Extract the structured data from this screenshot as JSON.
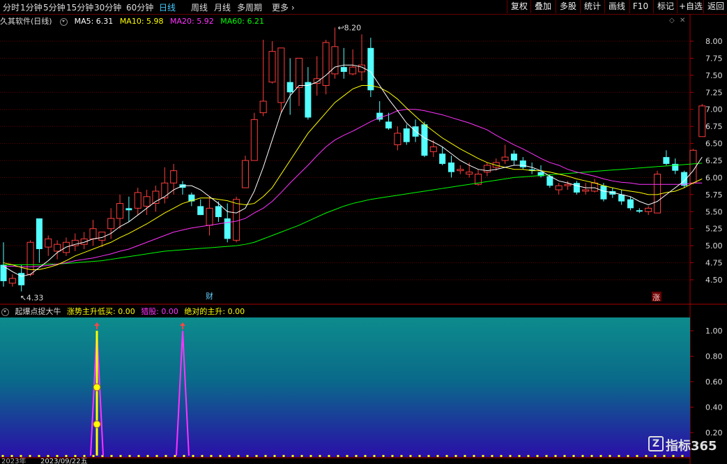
{
  "toolbar": {
    "timeframes": [
      {
        "label": "分时"
      },
      {
        "label": "1分钟"
      },
      {
        "label": "5分钟"
      },
      {
        "label": "15分钟"
      },
      {
        "label": "30分钟"
      },
      {
        "label": "60分钟"
      },
      {
        "label": "日线",
        "active": true
      },
      {
        "label": "周线"
      },
      {
        "label": "月线"
      },
      {
        "label": "多周期"
      },
      {
        "label": "更多"
      }
    ],
    "right_buttons": [
      {
        "label": "复权"
      },
      {
        "label": "叠加"
      },
      {
        "label": "多股"
      },
      {
        "label": "统计"
      },
      {
        "label": "画线"
      },
      {
        "label": "F10"
      },
      {
        "label": "标记"
      },
      {
        "label": "+自选"
      },
      {
        "label": "返回"
      }
    ]
  },
  "main_info": {
    "title": "久其软件(日线)",
    "ma5": "MA5: 6.31",
    "ma10": "MA10: 5.98",
    "ma20": "MA20: 5.92",
    "ma60": "MA60: 6.21"
  },
  "sub_info": {
    "indicator": "起爆点捉大牛",
    "v1": "涨势主升低买: 0.00",
    "v2": "猎股: 0.00",
    "v3": "绝对的主升: 0.00"
  },
  "annotations": {
    "high": "8.20",
    "low": "4.33",
    "cai": "财",
    "zhang": "涨",
    "date_label": "2023/09/22五",
    "yr_label": "2023年"
  },
  "chart_data": [
    {
      "type": "candlestick",
      "y_axis_ticks": [
        "8.00",
        "7.75",
        "7.50",
        "7.25",
        "7.00",
        "6.75",
        "6.50",
        "6.25",
        "6.00",
        "5.75",
        "5.50",
        "5.25",
        "5.00",
        "4.75",
        "4.50"
      ],
      "ylim": [
        4.33,
        8.2
      ],
      "candles": [
        {
          "o": 4.72,
          "h": 5.05,
          "l": 4.4,
          "c": 4.48
        },
        {
          "o": 4.45,
          "h": 4.58,
          "l": 4.4,
          "c": 4.52
        },
        {
          "o": 4.6,
          "h": 4.72,
          "l": 4.33,
          "c": 4.42
        },
        {
          "o": 4.58,
          "h": 5.08,
          "l": 4.55,
          "c": 5.05
        },
        {
          "o": 5.4,
          "h": 5.4,
          "l": 4.75,
          "c": 4.95
        },
        {
          "o": 4.98,
          "h": 5.15,
          "l": 4.85,
          "c": 5.1
        },
        {
          "o": 4.92,
          "h": 5.08,
          "l": 4.8,
          "c": 5.02
        },
        {
          "o": 4.9,
          "h": 5.12,
          "l": 4.85,
          "c": 5.05
        },
        {
          "o": 5.0,
          "h": 5.18,
          "l": 4.92,
          "c": 5.08
        },
        {
          "o": 5.02,
          "h": 5.2,
          "l": 4.95,
          "c": 5.1
        },
        {
          "o": 5.1,
          "h": 5.38,
          "l": 5.0,
          "c": 5.25
        },
        {
          "o": 5.08,
          "h": 5.12,
          "l": 4.98,
          "c": 5.2
        },
        {
          "o": 5.25,
          "h": 5.55,
          "l": 5.1,
          "c": 5.4
        },
        {
          "o": 5.4,
          "h": 5.75,
          "l": 5.25,
          "c": 5.62
        },
        {
          "o": 5.55,
          "h": 5.72,
          "l": 5.35,
          "c": 5.52
        },
        {
          "o": 5.55,
          "h": 5.85,
          "l": 5.45,
          "c": 5.78
        },
        {
          "o": 5.58,
          "h": 5.82,
          "l": 5.45,
          "c": 5.72
        },
        {
          "o": 5.62,
          "h": 5.88,
          "l": 5.5,
          "c": 5.8
        },
        {
          "o": 5.7,
          "h": 6.15,
          "l": 5.62,
          "c": 5.92
        },
        {
          "o": 5.92,
          "h": 6.2,
          "l": 5.75,
          "c": 6.1
        },
        {
          "o": 5.9,
          "h": 5.95,
          "l": 5.75,
          "c": 5.85
        },
        {
          "o": 5.75,
          "h": 5.78,
          "l": 5.58,
          "c": 5.65
        },
        {
          "o": 5.58,
          "h": 5.68,
          "l": 5.45,
          "c": 5.45
        },
        {
          "o": 5.3,
          "h": 5.72,
          "l": 5.15,
          "c": 5.55
        },
        {
          "o": 5.58,
          "h": 5.65,
          "l": 5.35,
          "c": 5.42
        },
        {
          "o": 5.4,
          "h": 5.62,
          "l": 5.05,
          "c": 5.1
        },
        {
          "o": 5.08,
          "h": 5.72,
          "l": 5.05,
          "c": 5.68
        },
        {
          "o": 5.85,
          "h": 6.32,
          "l": 5.85,
          "c": 6.25
        },
        {
          "o": 6.25,
          "h": 6.95,
          "l": 6.25,
          "c": 6.85
        },
        {
          "o": 6.95,
          "h": 8.02,
          "l": 6.9,
          "c": 7.12
        },
        {
          "o": 7.4,
          "h": 8.0,
          "l": 7.38,
          "c": 7.85
        },
        {
          "o": 7.1,
          "h": 7.85,
          "l": 6.95,
          "c": 7.9
        },
        {
          "o": 7.4,
          "h": 7.75,
          "l": 6.92,
          "c": 7.25
        },
        {
          "o": 7.32,
          "h": 7.75,
          "l": 7.05,
          "c": 7.75
        },
        {
          "o": 7.4,
          "h": 7.62,
          "l": 6.85,
          "c": 6.88
        },
        {
          "o": 7.38,
          "h": 7.78,
          "l": 7.2,
          "c": 7.45
        },
        {
          "o": 7.35,
          "h": 8.02,
          "l": 7.22,
          "c": 7.98
        },
        {
          "o": 7.52,
          "h": 8.2,
          "l": 7.45,
          "c": 7.92
        },
        {
          "o": 7.62,
          "h": 7.9,
          "l": 7.45,
          "c": 7.55
        },
        {
          "o": 7.52,
          "h": 7.88,
          "l": 7.5,
          "c": 7.62
        },
        {
          "o": 7.55,
          "h": 8.1,
          "l": 7.42,
          "c": 7.65
        },
        {
          "o": 7.9,
          "h": 8.05,
          "l": 7.18,
          "c": 7.28
        },
        {
          "o": 6.95,
          "h": 7.12,
          "l": 6.82,
          "c": 6.85
        },
        {
          "o": 6.82,
          "h": 6.95,
          "l": 6.7,
          "c": 6.72
        },
        {
          "o": 6.48,
          "h": 6.75,
          "l": 6.4,
          "c": 6.65
        },
        {
          "o": 6.72,
          "h": 6.78,
          "l": 6.48,
          "c": 6.52
        },
        {
          "o": 6.75,
          "h": 6.85,
          "l": 6.52,
          "c": 6.6
        },
        {
          "o": 6.78,
          "h": 6.82,
          "l": 6.3,
          "c": 6.32
        },
        {
          "o": 6.38,
          "h": 6.55,
          "l": 6.3,
          "c": 6.45
        },
        {
          "o": 6.35,
          "h": 6.45,
          "l": 6.18,
          "c": 6.2
        },
        {
          "o": 6.22,
          "h": 6.32,
          "l": 6.0,
          "c": 6.08
        },
        {
          "o": 6.1,
          "h": 6.18,
          "l": 6.05,
          "c": 6.12
        },
        {
          "o": 6.05,
          "h": 6.22,
          "l": 6.0,
          "c": 6.08
        },
        {
          "o": 5.9,
          "h": 6.12,
          "l": 5.88,
          "c": 6.05
        },
        {
          "o": 6.08,
          "h": 6.22,
          "l": 6.02,
          "c": 6.18
        },
        {
          "o": 6.15,
          "h": 6.28,
          "l": 6.1,
          "c": 6.22
        },
        {
          "o": 6.25,
          "h": 6.48,
          "l": 6.2,
          "c": 6.3
        },
        {
          "o": 6.35,
          "h": 6.4,
          "l": 6.18,
          "c": 6.25
        },
        {
          "o": 6.25,
          "h": 6.3,
          "l": 6.12,
          "c": 6.15
        },
        {
          "o": 6.12,
          "h": 6.22,
          "l": 6.05,
          "c": 6.1
        },
        {
          "o": 6.08,
          "h": 6.18,
          "l": 6.0,
          "c": 6.02
        },
        {
          "o": 6.02,
          "h": 6.05,
          "l": 5.85,
          "c": 5.88
        },
        {
          "o": 5.82,
          "h": 5.92,
          "l": 5.75,
          "c": 5.88
        },
        {
          "o": 5.88,
          "h": 5.95,
          "l": 5.82,
          "c": 5.9
        },
        {
          "o": 5.92,
          "h": 5.95,
          "l": 5.75,
          "c": 5.78
        },
        {
          "o": 5.8,
          "h": 5.92,
          "l": 5.75,
          "c": 5.82
        },
        {
          "o": 5.8,
          "h": 5.98,
          "l": 5.78,
          "c": 5.92
        },
        {
          "o": 5.88,
          "h": 5.92,
          "l": 5.65,
          "c": 5.68
        },
        {
          "o": 5.8,
          "h": 5.85,
          "l": 5.7,
          "c": 5.75
        },
        {
          "o": 5.75,
          "h": 5.82,
          "l": 5.6,
          "c": 5.65
        },
        {
          "o": 5.68,
          "h": 5.72,
          "l": 5.52,
          "c": 5.55
        },
        {
          "o": 5.52,
          "h": 5.55,
          "l": 5.48,
          "c": 5.5
        },
        {
          "o": 5.5,
          "h": 5.58,
          "l": 5.45,
          "c": 5.55
        },
        {
          "o": 5.48,
          "h": 6.1,
          "l": 5.48,
          "c": 6.05
        },
        {
          "o": 6.3,
          "h": 6.4,
          "l": 6.18,
          "c": 6.2
        },
        {
          "o": 6.2,
          "h": 6.28,
          "l": 6.05,
          "c": 6.1
        },
        {
          "o": 6.08,
          "h": 6.1,
          "l": 5.85,
          "c": 5.88
        },
        {
          "o": 5.92,
          "h": 6.42,
          "l": 5.9,
          "c": 6.4
        },
        {
          "o": 6.6,
          "h": 7.08,
          "l": 6.6,
          "c": 7.05
        }
      ],
      "ma5": [
        4.7,
        4.62,
        4.55,
        4.58,
        4.68,
        4.78,
        4.9,
        4.98,
        5.02,
        5.05,
        5.1,
        5.12,
        5.18,
        5.28,
        5.35,
        5.45,
        5.55,
        5.65,
        5.72,
        5.82,
        5.88,
        5.88,
        5.82,
        5.72,
        5.62,
        5.5,
        5.48,
        5.55,
        5.8,
        6.15,
        6.55,
        6.95,
        7.2,
        7.35,
        7.35,
        7.4,
        7.5,
        7.62,
        7.65,
        7.65,
        7.62,
        7.55,
        7.35,
        7.15,
        6.98,
        6.8,
        6.68,
        6.58,
        6.52,
        6.45,
        6.35,
        6.25,
        6.18,
        6.12,
        6.1,
        6.12,
        6.15,
        6.18,
        6.18,
        6.15,
        6.1,
        6.02,
        5.95,
        5.92,
        5.88,
        5.85,
        5.85,
        5.8,
        5.78,
        5.75,
        5.72,
        5.65,
        5.6,
        5.65,
        5.75,
        5.85,
        5.95,
        6.1,
        6.3
      ],
      "ma10": [
        4.75,
        4.72,
        4.68,
        4.65,
        4.65,
        4.68,
        4.72,
        4.78,
        4.85,
        4.9,
        4.95,
        5.0,
        5.05,
        5.12,
        5.18,
        5.25,
        5.32,
        5.4,
        5.48,
        5.55,
        5.62,
        5.66,
        5.7,
        5.7,
        5.68,
        5.66,
        5.62,
        5.6,
        5.62,
        5.72,
        5.85,
        6.05,
        6.25,
        6.45,
        6.65,
        6.8,
        6.95,
        7.1,
        7.2,
        7.3,
        7.35,
        7.35,
        7.32,
        7.25,
        7.15,
        7.02,
        6.9,
        6.78,
        6.68,
        6.58,
        6.5,
        6.42,
        6.35,
        6.28,
        6.22,
        6.18,
        6.15,
        6.12,
        6.12,
        6.1,
        6.1,
        6.08,
        6.05,
        6.02,
        5.98,
        5.95,
        5.92,
        5.88,
        5.85,
        5.82,
        5.8,
        5.78,
        5.75,
        5.75,
        5.78,
        5.8,
        5.85,
        5.92,
        5.98
      ],
      "ma20": [
        4.7,
        4.7,
        4.69,
        4.69,
        4.7,
        4.71,
        4.73,
        4.75,
        4.78,
        4.8,
        4.82,
        4.85,
        4.88,
        4.92,
        4.95,
        5.0,
        5.05,
        5.1,
        5.15,
        5.2,
        5.23,
        5.26,
        5.28,
        5.3,
        5.32,
        5.34,
        5.36,
        5.4,
        5.48,
        5.55,
        5.65,
        5.78,
        5.92,
        6.05,
        6.18,
        6.32,
        6.45,
        6.55,
        6.62,
        6.68,
        6.75,
        6.82,
        6.88,
        6.92,
        6.98,
        7.0,
        7.0,
        6.98,
        6.95,
        6.92,
        6.88,
        6.84,
        6.8,
        6.75,
        6.7,
        6.62,
        6.55,
        6.48,
        6.42,
        6.35,
        6.28,
        6.22,
        6.18,
        6.12,
        6.08,
        6.05,
        6.02,
        5.98,
        5.95,
        5.93,
        5.92,
        5.9,
        5.9,
        5.9,
        5.9,
        5.9,
        5.9,
        5.92,
        5.92
      ],
      "ma60": [
        4.72,
        4.72,
        4.72,
        4.72,
        4.72,
        4.73,
        4.73,
        4.74,
        4.75,
        4.76,
        4.77,
        4.78,
        4.8,
        4.82,
        4.84,
        4.86,
        4.88,
        4.9,
        4.92,
        4.93,
        4.94,
        4.95,
        4.96,
        4.97,
        4.98,
        4.99,
        5.0,
        5.02,
        5.05,
        5.1,
        5.15,
        5.2,
        5.25,
        5.3,
        5.36,
        5.42,
        5.48,
        5.53,
        5.58,
        5.62,
        5.65,
        5.68,
        5.7,
        5.72,
        5.74,
        5.76,
        5.78,
        5.8,
        5.82,
        5.84,
        5.86,
        5.88,
        5.9,
        5.92,
        5.94,
        5.96,
        5.98,
        6.0,
        6.01,
        6.02,
        6.03,
        6.04,
        6.05,
        6.06,
        6.07,
        6.08,
        6.09,
        6.1,
        6.11,
        6.12,
        6.13,
        6.14,
        6.15,
        6.16,
        6.17,
        6.18,
        6.19,
        6.2,
        6.21
      ]
    },
    {
      "type": "line",
      "y_axis_ticks": [
        "1.00",
        "0.80",
        "0.60",
        "0.40",
        "0.20"
      ],
      "ylim": [
        0,
        1.0
      ],
      "spikes": [
        {
          "index": 10,
          "value": 1.0
        },
        {
          "index": 20,
          "value": 1.0
        }
      ]
    }
  ],
  "colors": {
    "up": "#ff3d3d",
    "down": "#54ffff",
    "ma5": "#ffffff",
    "ma10": "#ffff00",
    "ma20": "#ff33ff",
    "ma60": "#00ff00",
    "grid": "#6a0000"
  }
}
